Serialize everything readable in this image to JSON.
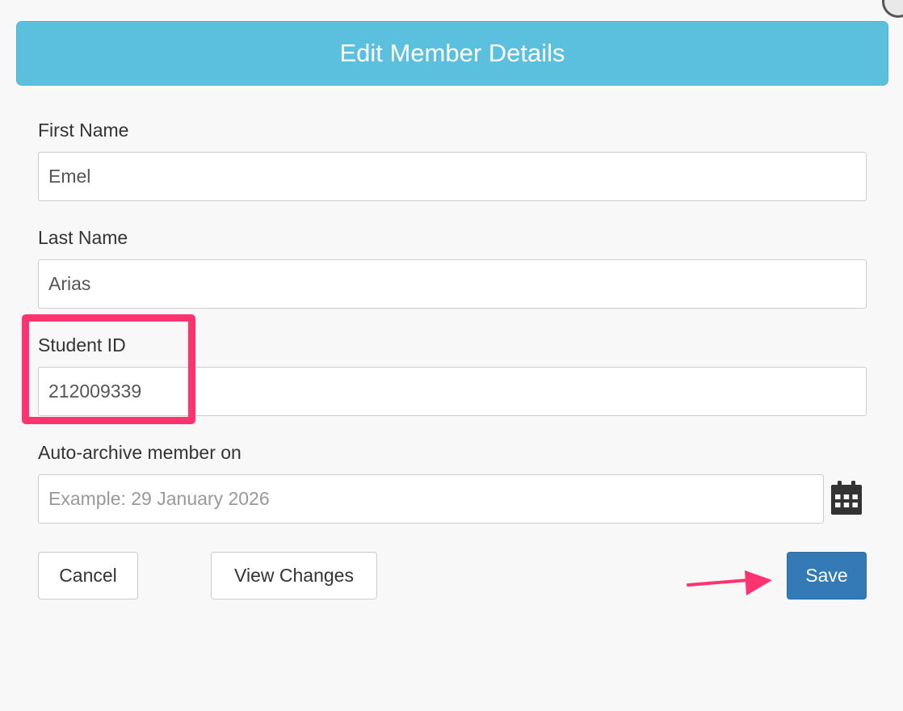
{
  "modal": {
    "title": "Edit Member Details"
  },
  "form": {
    "first_name": {
      "label": "First Name",
      "value": "Emel"
    },
    "last_name": {
      "label": "Last Name",
      "value": "Arias"
    },
    "student_id": {
      "label": "Student ID",
      "value": "212009339"
    },
    "auto_archive": {
      "label": "Auto-archive member on",
      "value": "",
      "placeholder": "Example: 29 January 2026",
      "icon": "calendar-icon"
    }
  },
  "buttons": {
    "cancel": "Cancel",
    "view_changes": "View Changes",
    "save": "Save"
  },
  "annotations": {
    "highlight_color": "#ff3370",
    "arrow_color": "#ff3370"
  },
  "colors": {
    "header_bg": "#5bc0de",
    "primary": "#337ab7"
  }
}
